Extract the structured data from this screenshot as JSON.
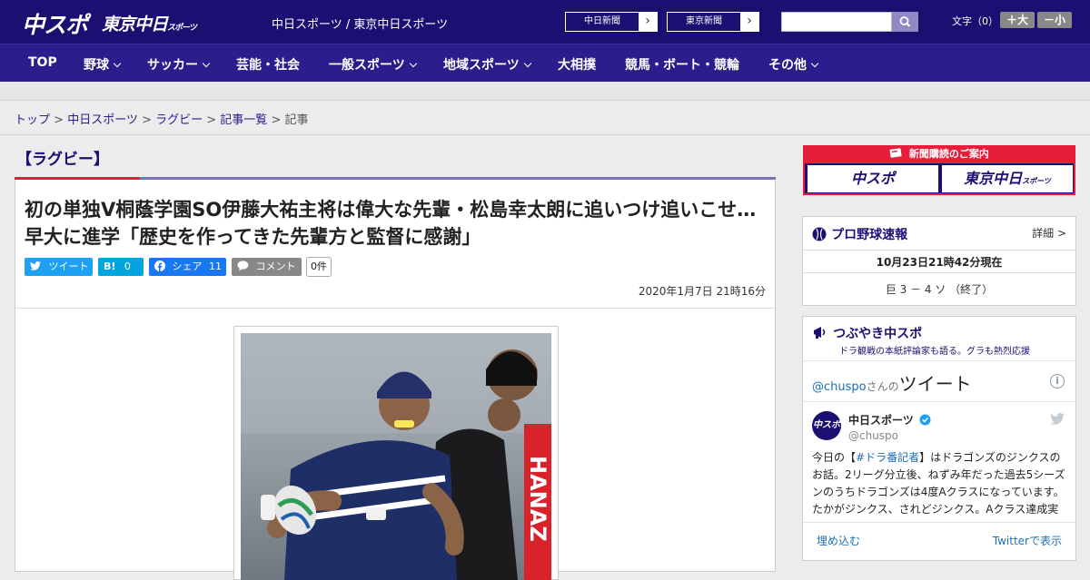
{
  "header": {
    "logo_main": "中スポ",
    "logo_tokyo": "東京中日",
    "logo_tokyo_small": "スポーツ",
    "site_name": "中日スポーツ / 東京中日スポーツ",
    "ext_links": [
      "中日新聞",
      "東京新聞"
    ],
    "font_size_label": "文字（0）",
    "font_plus": "＋大",
    "font_minus": "－小"
  },
  "nav": {
    "items": [
      "TOP",
      "野球",
      "サッカー",
      "芸能・社会",
      "一般スポーツ",
      "地域スポーツ",
      "大相撲",
      "競馬・ボート・競輪",
      "その他"
    ]
  },
  "breadcrumb": {
    "items": [
      "トップ",
      "中日スポーツ",
      "ラグビー",
      "記事一覧"
    ],
    "current": "記事"
  },
  "article": {
    "category": "【ラグビー】",
    "headline": "初の単独V桐蔭学園SO伊藤大祐主将は偉大な先輩・松島幸太朗に追いつけ追いこせ…早大に進学「歴史を作ってきた先輩方と監督に感謝」",
    "share": {
      "twitter": "ツイート",
      "hatena_icon": "B!",
      "hatena_count": "0",
      "facebook": "シェア",
      "facebook_count": "11",
      "comment": "コメント",
      "comment_count": "0件"
    },
    "date": "2020年1月7日 21時16分",
    "photo_text": "HANAZ"
  },
  "sidebar": {
    "ad_title": "新聞購読のご案内",
    "ad_buttons": [
      "中スポ",
      "東京中日"
    ],
    "ad_small": "スポーツ",
    "baseball": {
      "title": "プロ野球速報",
      "more": "詳細 >",
      "updated": "10月23日21時42分現在",
      "score": "巨 3 － 4 ソ （終了）"
    },
    "tweets": {
      "title": "つぶやき中スポ",
      "subtitle": "ドラ観戦の本紙評論家も語る。グラも熱烈応援",
      "handle_prefix": "@chuspo",
      "handle_suffix": "さんの",
      "tweet_label": "ツイート",
      "account_name": "中日スポーツ",
      "account_handle": "@chuspo",
      "avatar_text": "中スポ",
      "text_pre": "今日の【",
      "hashtag": "#ドラ番記者",
      "text_post": "】はドラゴンズのジンクスのお話。2リーグ分立後、ねずみ年だった過去5シーズンのうちドラゴンズは4度Aクラスになっています。たかがジンクス、されどジンクス。Aクラス達成実",
      "embed": "埋め込む",
      "view_on_twitter": "Twitterで表示"
    }
  },
  "colors": {
    "navy": "#1b0f72",
    "red": "#e61e3c",
    "twitter": "#1da1f2",
    "hatena": "#00a4de",
    "facebook": "#1877f2"
  }
}
